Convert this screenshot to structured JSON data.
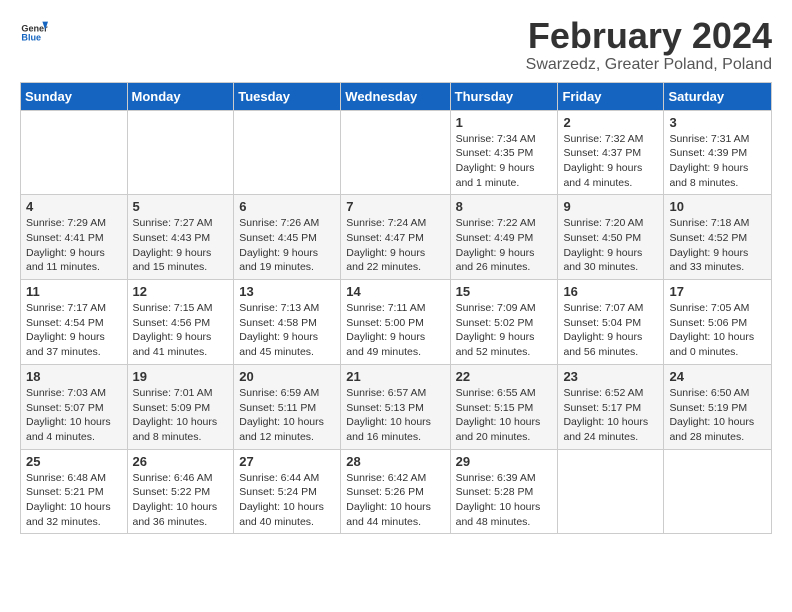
{
  "logo": {
    "general": "General",
    "blue": "Blue"
  },
  "title": "February 2024",
  "subtitle": "Swarzedz, Greater Poland, Poland",
  "headers": [
    "Sunday",
    "Monday",
    "Tuesday",
    "Wednesday",
    "Thursday",
    "Friday",
    "Saturday"
  ],
  "weeks": [
    [
      {
        "day": "",
        "info": ""
      },
      {
        "day": "",
        "info": ""
      },
      {
        "day": "",
        "info": ""
      },
      {
        "day": "",
        "info": ""
      },
      {
        "day": "1",
        "info": "Sunrise: 7:34 AM\nSunset: 4:35 PM\nDaylight: 9 hours and 1 minute."
      },
      {
        "day": "2",
        "info": "Sunrise: 7:32 AM\nSunset: 4:37 PM\nDaylight: 9 hours and 4 minutes."
      },
      {
        "day": "3",
        "info": "Sunrise: 7:31 AM\nSunset: 4:39 PM\nDaylight: 9 hours and 8 minutes."
      }
    ],
    [
      {
        "day": "4",
        "info": "Sunrise: 7:29 AM\nSunset: 4:41 PM\nDaylight: 9 hours and 11 minutes."
      },
      {
        "day": "5",
        "info": "Sunrise: 7:27 AM\nSunset: 4:43 PM\nDaylight: 9 hours and 15 minutes."
      },
      {
        "day": "6",
        "info": "Sunrise: 7:26 AM\nSunset: 4:45 PM\nDaylight: 9 hours and 19 minutes."
      },
      {
        "day": "7",
        "info": "Sunrise: 7:24 AM\nSunset: 4:47 PM\nDaylight: 9 hours and 22 minutes."
      },
      {
        "day": "8",
        "info": "Sunrise: 7:22 AM\nSunset: 4:49 PM\nDaylight: 9 hours and 26 minutes."
      },
      {
        "day": "9",
        "info": "Sunrise: 7:20 AM\nSunset: 4:50 PM\nDaylight: 9 hours and 30 minutes."
      },
      {
        "day": "10",
        "info": "Sunrise: 7:18 AM\nSunset: 4:52 PM\nDaylight: 9 hours and 33 minutes."
      }
    ],
    [
      {
        "day": "11",
        "info": "Sunrise: 7:17 AM\nSunset: 4:54 PM\nDaylight: 9 hours and 37 minutes."
      },
      {
        "day": "12",
        "info": "Sunrise: 7:15 AM\nSunset: 4:56 PM\nDaylight: 9 hours and 41 minutes."
      },
      {
        "day": "13",
        "info": "Sunrise: 7:13 AM\nSunset: 4:58 PM\nDaylight: 9 hours and 45 minutes."
      },
      {
        "day": "14",
        "info": "Sunrise: 7:11 AM\nSunset: 5:00 PM\nDaylight: 9 hours and 49 minutes."
      },
      {
        "day": "15",
        "info": "Sunrise: 7:09 AM\nSunset: 5:02 PM\nDaylight: 9 hours and 52 minutes."
      },
      {
        "day": "16",
        "info": "Sunrise: 7:07 AM\nSunset: 5:04 PM\nDaylight: 9 hours and 56 minutes."
      },
      {
        "day": "17",
        "info": "Sunrise: 7:05 AM\nSunset: 5:06 PM\nDaylight: 10 hours and 0 minutes."
      }
    ],
    [
      {
        "day": "18",
        "info": "Sunrise: 7:03 AM\nSunset: 5:07 PM\nDaylight: 10 hours and 4 minutes."
      },
      {
        "day": "19",
        "info": "Sunrise: 7:01 AM\nSunset: 5:09 PM\nDaylight: 10 hours and 8 minutes."
      },
      {
        "day": "20",
        "info": "Sunrise: 6:59 AM\nSunset: 5:11 PM\nDaylight: 10 hours and 12 minutes."
      },
      {
        "day": "21",
        "info": "Sunrise: 6:57 AM\nSunset: 5:13 PM\nDaylight: 10 hours and 16 minutes."
      },
      {
        "day": "22",
        "info": "Sunrise: 6:55 AM\nSunset: 5:15 PM\nDaylight: 10 hours and 20 minutes."
      },
      {
        "day": "23",
        "info": "Sunrise: 6:52 AM\nSunset: 5:17 PM\nDaylight: 10 hours and 24 minutes."
      },
      {
        "day": "24",
        "info": "Sunrise: 6:50 AM\nSunset: 5:19 PM\nDaylight: 10 hours and 28 minutes."
      }
    ],
    [
      {
        "day": "25",
        "info": "Sunrise: 6:48 AM\nSunset: 5:21 PM\nDaylight: 10 hours and 32 minutes."
      },
      {
        "day": "26",
        "info": "Sunrise: 6:46 AM\nSunset: 5:22 PM\nDaylight: 10 hours and 36 minutes."
      },
      {
        "day": "27",
        "info": "Sunrise: 6:44 AM\nSunset: 5:24 PM\nDaylight: 10 hours and 40 minutes."
      },
      {
        "day": "28",
        "info": "Sunrise: 6:42 AM\nSunset: 5:26 PM\nDaylight: 10 hours and 44 minutes."
      },
      {
        "day": "29",
        "info": "Sunrise: 6:39 AM\nSunset: 5:28 PM\nDaylight: 10 hours and 48 minutes."
      },
      {
        "day": "",
        "info": ""
      },
      {
        "day": "",
        "info": ""
      }
    ]
  ]
}
